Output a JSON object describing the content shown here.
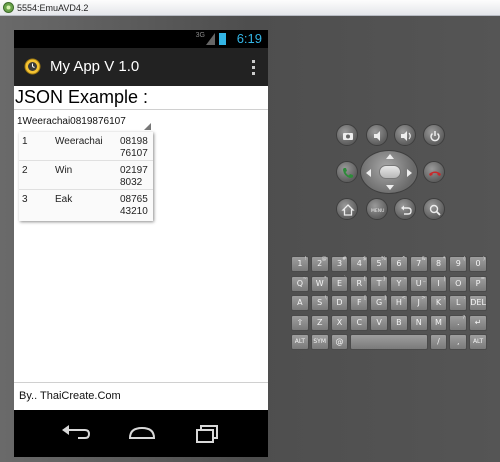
{
  "window": {
    "title": "5554:EmuAVD4.2"
  },
  "statusbar": {
    "network": "3G",
    "time": "6:19"
  },
  "app": {
    "title": "My App V 1.0"
  },
  "heading": "JSON Example :",
  "spinner": {
    "selected": "1Weerachai0819876107"
  },
  "dropdown": {
    "rows": [
      {
        "id": "1",
        "name": "Weerachai",
        "tel": "08198\n76107"
      },
      {
        "id": "2",
        "name": "Win",
        "tel": "02197\n8032"
      },
      {
        "id": "3",
        "name": "Eak",
        "tel": "08765\n43210"
      }
    ]
  },
  "footer": "By.. ThaiCreate.Com",
  "keyboard": {
    "row1": [
      "1",
      "2",
      "3",
      "4",
      "5",
      "6",
      "7",
      "8",
      "9",
      "0"
    ],
    "row1_sub": [
      "!",
      "@",
      "#",
      "$",
      "%",
      "^",
      "&",
      "*",
      "(",
      ")"
    ],
    "row2": [
      "Q",
      "W",
      "E",
      "R",
      "T",
      "Y",
      "U",
      "I",
      "O",
      "P"
    ],
    "row2_sub": [
      "~",
      "\"",
      "`",
      "{",
      "}",
      "-",
      "_",
      "|",
      "",
      "="
    ],
    "row3": [
      "A",
      "S",
      "D",
      "F",
      "G",
      "H",
      "J",
      "K",
      "L",
      "DEL"
    ],
    "row3_sub": [
      "",
      "\\",
      "",
      "[",
      "]",
      "<",
      ">",
      ";",
      ":",
      ""
    ],
    "row4": [
      "⇧",
      "Z",
      "X",
      "C",
      "V",
      "B",
      "N",
      "M",
      ".",
      "↵"
    ],
    "row4_sub": [
      "",
      "",
      "",
      "",
      "",
      "",
      "",
      "",
      "?",
      ""
    ],
    "row5": [
      "ALT",
      "SYM",
      "@",
      "",
      "/",
      ",",
      "ALT"
    ]
  },
  "colors": {
    "accent": "#33b5e5",
    "actionbar": "#222222",
    "call": "#2e8b3a",
    "hangup": "#c8282a"
  }
}
